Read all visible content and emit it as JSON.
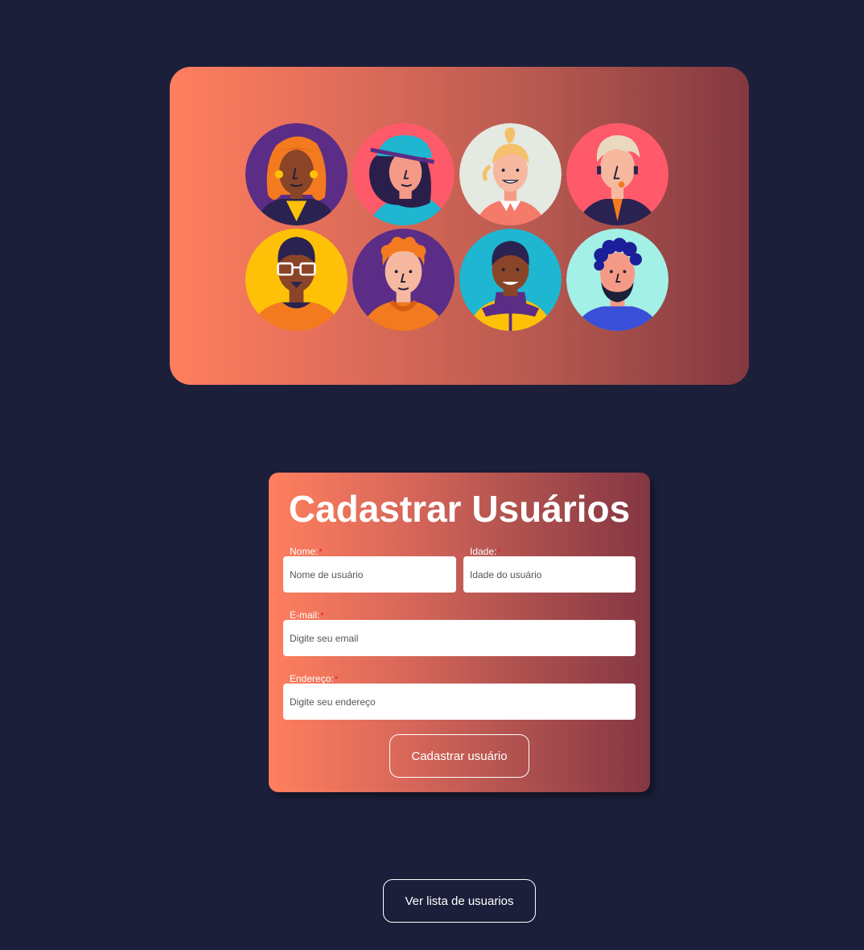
{
  "hero": {
    "avatars": [
      {
        "icon": "woman-curly-orange-hair-avatar",
        "bg": "#5b2d86"
      },
      {
        "icon": "woman-blue-cap-avatar",
        "bg": "#ff5a6a"
      },
      {
        "icon": "woman-blonde-ponytail-avatar",
        "bg": "#e4e9e1"
      },
      {
        "icon": "man-gray-hair-avatar",
        "bg": "#ff5a6a"
      },
      {
        "icon": "man-glasses-avatar",
        "bg": "#ffc107"
      },
      {
        "icon": "man-orange-curly-hair-avatar",
        "bg": "#5b2d86"
      },
      {
        "icon": "man-purple-jacket-avatar",
        "bg": "#1eb6d0"
      },
      {
        "icon": "man-beard-avatar",
        "bg": "#a3f0e6"
      }
    ]
  },
  "form": {
    "title": "Cadastrar Usuários",
    "required_marker": "*",
    "nome_label": "Nome:",
    "nome_placeholder": "Nome de usuário",
    "idade_label": "Idade:",
    "idade_placeholder": "Idade do usuário",
    "email_label": "E-mail:",
    "email_placeholder": "Digite seu email",
    "endereco_label": "Endereço:",
    "endereco_placeholder": "Digite seu endereço",
    "submit_label": "Cadastrar usuário"
  },
  "footer": {
    "list_button_label": "Ver lista de usuarios"
  },
  "colors": {
    "background": "#1b1f3a",
    "gradient_start": "#ff7f5e",
    "gradient_end": "#833840",
    "required": "#e01b24"
  }
}
